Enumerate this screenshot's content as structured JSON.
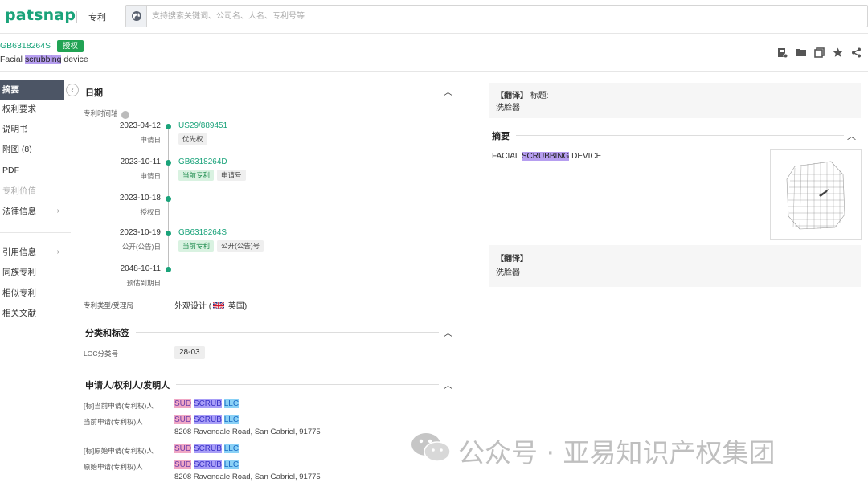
{
  "app": {
    "logo": "patsnap",
    "type_label": "专利"
  },
  "search": {
    "placeholder": "支持搜索关键词、公司名、人名、专利号等"
  },
  "patent": {
    "number": "GB6318264S",
    "status": "授权",
    "title_before": "Facial ",
    "title_highlight": "scrubbing",
    "title_after": " device"
  },
  "header_icons": [
    "add-note-icon",
    "folder-icon",
    "copy-icon",
    "star-icon",
    "share-icon"
  ],
  "nav": {
    "items": [
      {
        "label": "摘要",
        "state": "active"
      },
      {
        "label": "权利要求",
        "state": "normal"
      },
      {
        "label": "说明书",
        "state": "normal"
      },
      {
        "label": "附图 (8)",
        "state": "normal"
      },
      {
        "label": "PDF",
        "state": "normal"
      },
      {
        "label": "专利价值",
        "state": "disabled"
      },
      {
        "label": "法律信息",
        "state": "normal",
        "arrow": "›"
      },
      {
        "label": "引用信息",
        "state": "normal",
        "arrow": "›"
      },
      {
        "label": "同族专利",
        "state": "normal"
      },
      {
        "label": "相似专利",
        "state": "normal"
      },
      {
        "label": "相关文献",
        "state": "normal"
      }
    ]
  },
  "dates": {
    "title": "日期",
    "timeline_label": "专利时间轴",
    "events": [
      {
        "date": "2023-04-12",
        "sub": "申请日",
        "link": "US29/889451",
        "tags": [
          "优先权"
        ]
      },
      {
        "date": "2023-10-11",
        "sub": "申请日",
        "link": "GB6318264D",
        "tags": [
          "当前专利",
          "申请号"
        ]
      },
      {
        "date": "2023-10-18",
        "sub": "授权日",
        "link": "",
        "tags": []
      },
      {
        "date": "2023-10-19",
        "sub": "公开(公告)日",
        "link": "GB6318264S",
        "tags": [
          "当前专利",
          "公开(公告)号"
        ]
      },
      {
        "date": "2048-10-11",
        "sub": "预估到期日",
        "link": "",
        "tags": []
      }
    ],
    "type_label": "专利类型/受理局",
    "type_value_before": "外观设计 (",
    "type_value_after": " 英国)"
  },
  "classification": {
    "title": "分类和标签",
    "loc_label": "LOC分类号",
    "loc_value": "28-03"
  },
  "applicants": {
    "title": "申请人/权利人/发明人",
    "name_parts": [
      "SUD",
      "SCRUB",
      "LLC"
    ],
    "rows": [
      {
        "label": "[标]当前申请(专利权)人",
        "address": ""
      },
      {
        "label": "当前申请(专利权)人",
        "address": "8208 Ravendale Road, San Gabriel, 91775"
      },
      {
        "label": "[标]原始申请(专利权)人",
        "address": ""
      },
      {
        "label": "原始申请(专利权)人",
        "address": "8208 Ravendale Road, San Gabriel, 91775"
      }
    ]
  },
  "right": {
    "translate_tag": "【翻译】",
    "title_label": "标题:",
    "title_zh": "洗脸器",
    "abstract_title": "摘要",
    "abstract_before": "FACIAL ",
    "abstract_highlight": "SCRUBBING",
    "abstract_after": " DEVICE",
    "abstract_zh": "洗脸器"
  },
  "watermark": {
    "text": "公众号 · 亚易知识产权集团"
  }
}
